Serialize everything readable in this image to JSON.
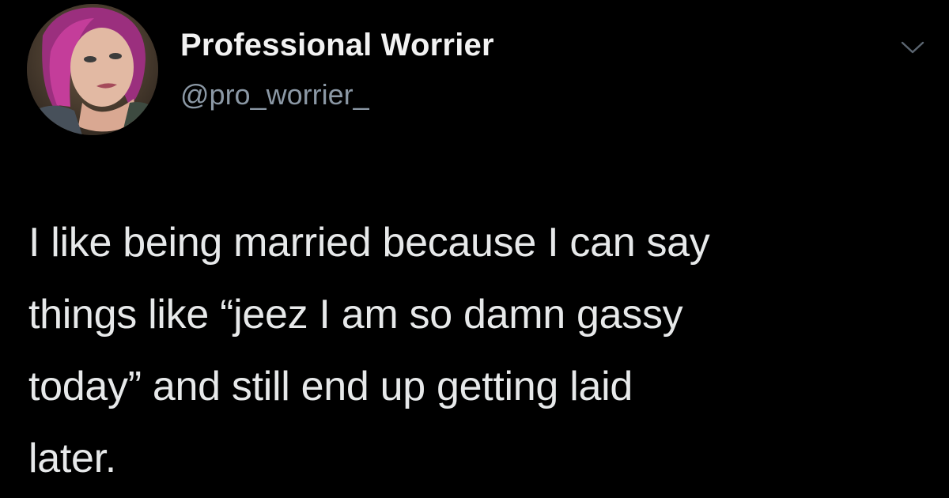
{
  "colors": {
    "background": "#000000",
    "name": "#f2f2f2",
    "handle": "#8b98a5",
    "text": "#e7e9ea"
  },
  "tweet": {
    "author": {
      "display_name": "Professional Worrier",
      "handle": "@pro_worrier_",
      "avatar_icon": "profile-photo"
    },
    "menu_icon": "chevron-down-icon",
    "text_lines": [
      "I like being married because I can say",
      "things like “jeez I am so damn gassy",
      "today” and still end up getting laid",
      "later."
    ]
  }
}
